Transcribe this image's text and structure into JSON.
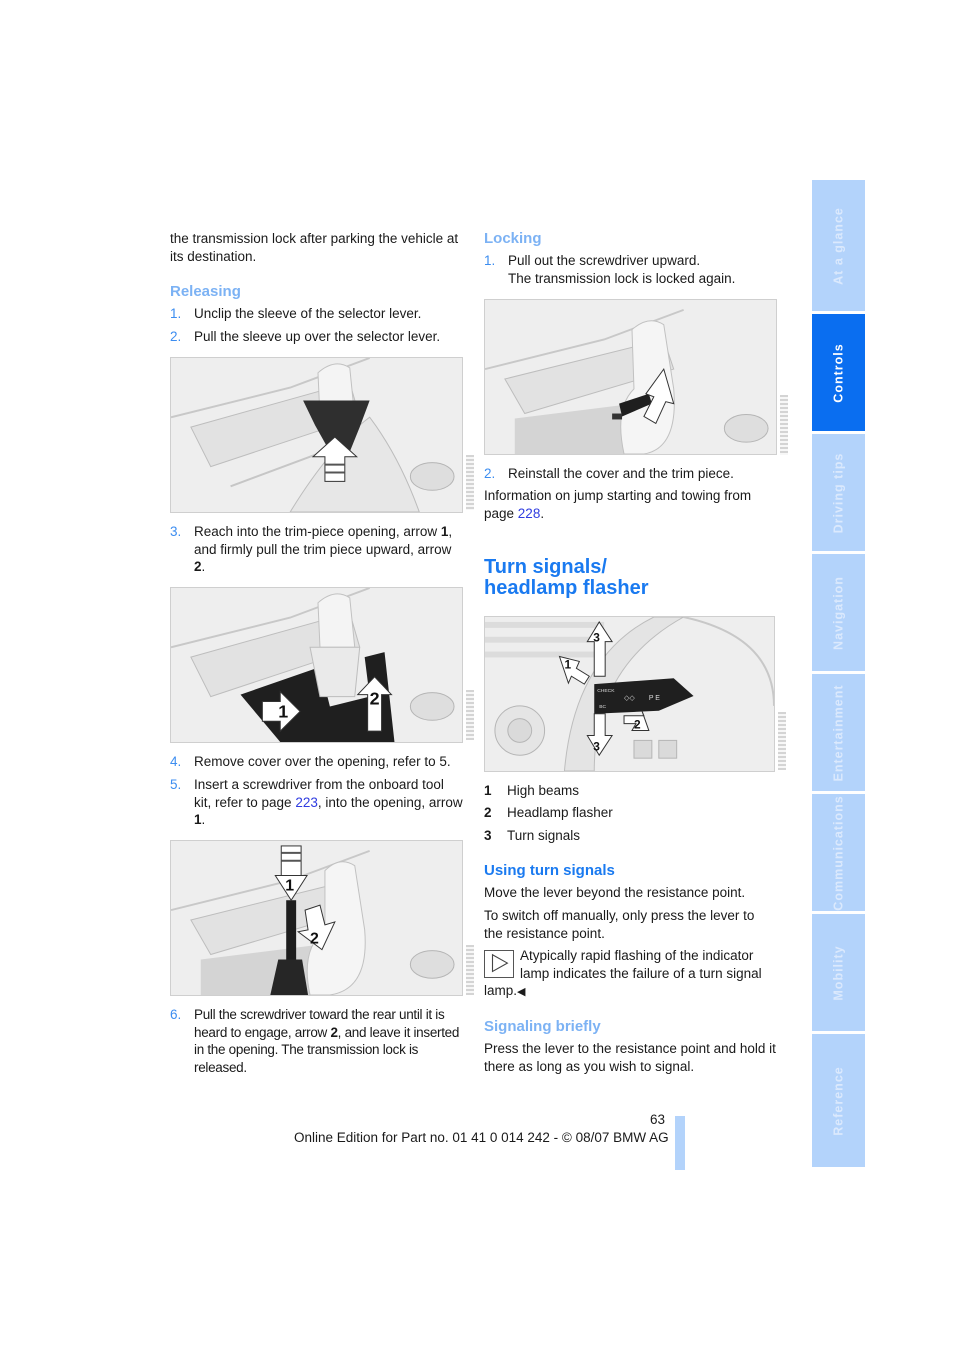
{
  "left_column": {
    "intro": "the transmission lock after parking the vehicle at its destination.",
    "releasing": {
      "heading": "Releasing",
      "steps": [
        {
          "num": "1.",
          "text": "Unclip the sleeve of the selector lever."
        },
        {
          "num": "2.",
          "text": "Pull the sleeve up over the selector lever."
        },
        {
          "num": "3.",
          "text_a": "Reach into the trim-piece opening, arrow ",
          "bold_a": "1",
          "text_b": ", and firmly pull the trim piece upward, arrow ",
          "bold_b": "2",
          "text_c": "."
        },
        {
          "num": "4.",
          "text": "Remove cover over the opening, refer to 5."
        },
        {
          "num": "5.",
          "text_a": "Insert a screwdriver from the onboard tool kit, refer to page ",
          "link": "223",
          "text_b": ", into the opening, arrow ",
          "bold": "1",
          "text_c": "."
        },
        {
          "num": "6.",
          "text_a": "Pull the screwdriver toward the rear until it is heard to engage, arrow ",
          "bold": "2",
          "text_b": ", and leave it inserted in the opening. The transmission lock is released."
        }
      ]
    },
    "figures": [
      {
        "name": "sleeve-pull-up-illustration",
        "arrows": [
          "up"
        ]
      },
      {
        "name": "trim-piece-illustration",
        "arrows": [
          "1",
          "2"
        ]
      },
      {
        "name": "screwdriver-insert-illustration",
        "arrows": [
          "1",
          "2"
        ]
      }
    ]
  },
  "right_column": {
    "locking": {
      "heading": "Locking",
      "step1_num": "1.",
      "step1_text": "Pull out the screwdriver upward.",
      "step1_sub": "The transmission lock is locked again.",
      "step2_num": "2.",
      "step2_text": "Reinstall the cover and the trim piece."
    },
    "info_a": "Information on jump starting and towing from page ",
    "info_link": "228",
    "info_b": ".",
    "section_title_line1": "Turn signals/",
    "section_title_line2": "headlamp flasher",
    "lever_figure": {
      "arrow_labels": [
        "1",
        "2",
        "3",
        "3"
      ],
      "lever_texts": [
        "CHECK",
        "BC",
        "P E"
      ]
    },
    "legend": [
      {
        "num": "1",
        "label": "High beams"
      },
      {
        "num": "2",
        "label": "Headlamp flasher"
      },
      {
        "num": "3",
        "label": "Turn signals"
      }
    ],
    "using": {
      "heading": "Using turn signals",
      "p1": "Move the lever beyond the resistance point.",
      "p2": "To switch off manually, only press the lever to the resistance point."
    },
    "note": {
      "line1": "Atypically rapid flashing of the indicator",
      "line2": "lamp indicates the failure of a turn signal",
      "line3": "lamp.",
      "end_mark": "◀"
    },
    "signaling": {
      "heading": "Signaling briefly",
      "p1": "Press the lever to the resistance point and hold it there as long as you wish to signal."
    }
  },
  "footer": {
    "page_number": "63",
    "edition": "Online Edition for Part no. 01 41 0 014 242 - © 08/07 BMW AG"
  },
  "side_tabs": [
    {
      "label": "At a glance",
      "active": false
    },
    {
      "label": "Controls",
      "active": true
    },
    {
      "label": "Driving tips",
      "active": false
    },
    {
      "label": "Navigation",
      "active": false
    },
    {
      "label": "Entertainment",
      "active": false
    },
    {
      "label": "Communications",
      "active": false
    },
    {
      "label": "Mobility",
      "active": false
    },
    {
      "label": "Reference",
      "active": false
    }
  ],
  "colors": {
    "accent": "#1a7af0",
    "subheading": "#7cb2f4",
    "tab_inactive": "#b3d3fb",
    "tab_active": "#0a6ef0",
    "link": "#2f3ce0"
  }
}
